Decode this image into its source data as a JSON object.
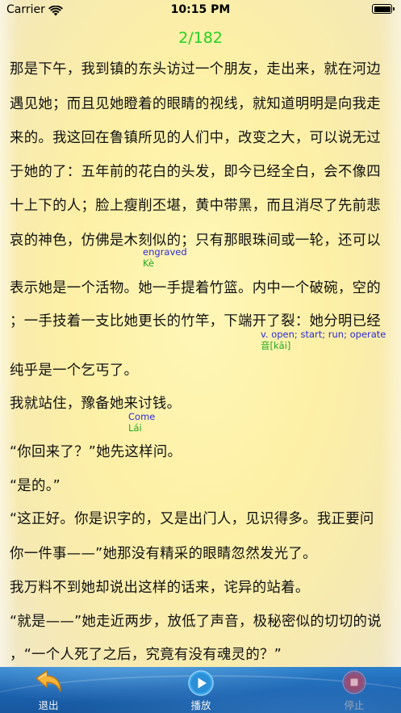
{
  "status_bar": {
    "carrier": "Carrier",
    "time": "10:15 PM"
  },
  "page_indicator": "2/182",
  "lines": [
    "那是下午，我到镇的东头访过一个朋友，走出来，就在河边",
    "遇见她；而且见她瞪着的眼睛的视线，就知道明明是向我走",
    "来的。我这回在鲁镇所见的人们中，改变之大，可以说无过",
    "于她的了：五年前的花白的头发，即今已经全白，会不像四",
    "十上下的人；脸上瘦削丕堪，黄中带黑，而且消尽了先前悲",
    "哀的神色，仿佛是木刻似的；只有那眼珠间或一轮，还可以",
    "表示她是一个活物。她一手提着竹篮。内中一个破碗，空的",
    "；一手技着一支比她更长的竹竿，下端开了裂：她分明已经",
    "纯乎是一个乞丐了。",
    "我就站住，豫备她来讨钱。",
    "“你回来了？”她先这样问。",
    "“是的。”",
    "“这正好。你是识字的，又是出门人，见识得多。我正要问",
    "你一件事——”她那没有精采的眼睛忽然发光了。",
    "我万料不到她却说出这样的话来，诧异的站着。",
    "“就是——”她走近两步，放低了声音，极秘密似的切切的说",
    "，“一个人死了之后，究竟有没有魂灵的？”"
  ],
  "glosses": [
    {
      "english": "engraved",
      "pinyin": "Kè"
    },
    {
      "english": "v. open; start; run; operate",
      "pinyin": "音[kāi]"
    },
    {
      "english": "Come",
      "pinyin": "Lái"
    }
  ],
  "toolbar": {
    "exit_label": "退出",
    "play_label": "播放",
    "stop_label": "停止"
  },
  "colors": {
    "page_indicator": "#22d122",
    "gloss_english": "#2a2ad8",
    "gloss_pinyin": "#22a822",
    "toolbar": "#1c63b0"
  }
}
